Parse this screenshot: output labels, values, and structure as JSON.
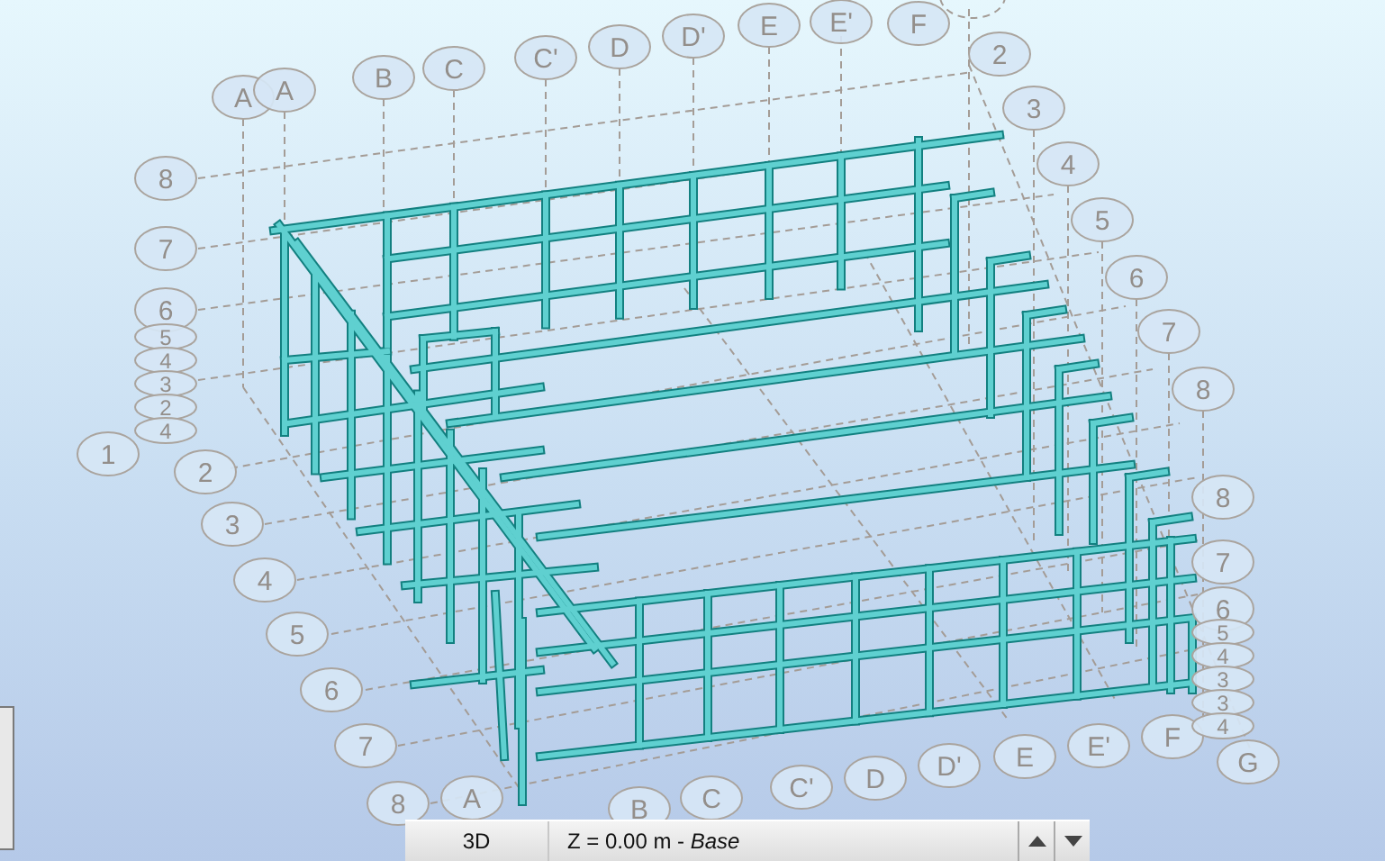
{
  "grid_axes": {
    "top": [
      "A",
      "A",
      "B",
      "C",
      "C'",
      "D",
      "D'",
      "E",
      "E'",
      "F"
    ],
    "right_upper": [
      "2",
      "3",
      "4",
      "5",
      "6",
      "7",
      "8"
    ],
    "left_upper": [
      "8",
      "7",
      "6",
      "5",
      "4",
      "3",
      "2",
      "4",
      "1"
    ],
    "left_lower": [
      "2",
      "3",
      "4",
      "5",
      "6",
      "7",
      "8",
      "A"
    ],
    "bottom": [
      "B",
      "C",
      "C'",
      "D",
      "D'",
      "E",
      "E'",
      "F",
      "G"
    ],
    "right_lower": [
      "8",
      "7",
      "6",
      "5",
      "4",
      "3",
      "3",
      "4"
    ]
  },
  "status_bar": {
    "view": "3D",
    "level": "Z = 0.00 m - *Base*"
  }
}
